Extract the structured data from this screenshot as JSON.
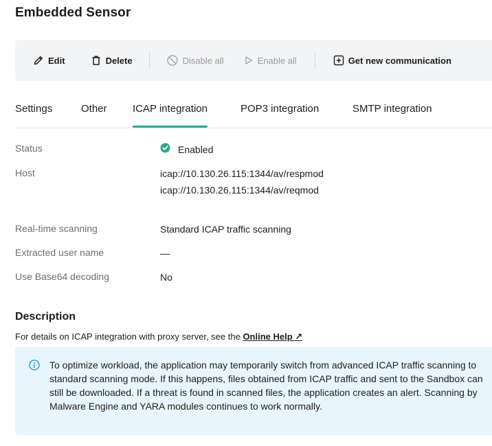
{
  "page": {
    "title": "Embedded Sensor"
  },
  "toolbar": {
    "edit_label": "Edit",
    "delete_label": "Delete",
    "disable_all_label": "Disable all",
    "enable_all_label": "Enable all",
    "get_comm_label": "Get new communication"
  },
  "tabs": [
    {
      "label": "Settings"
    },
    {
      "label": "Other"
    },
    {
      "label": "ICAP integration"
    },
    {
      "label": "POP3 integration"
    },
    {
      "label": "SMTP integration"
    }
  ],
  "details": {
    "status": {
      "label": "Status",
      "value": "Enabled"
    },
    "host": {
      "label": "Host",
      "values": [
        "icap://10.130.26.115:1344/av/respmod",
        "icap://10.130.26.115:1344/av/reqmod"
      ]
    },
    "realtime": {
      "label": "Real-time scanning",
      "value": "Standard ICAP traffic scanning"
    },
    "extracted_user": {
      "label": "Extracted user name",
      "value": "—"
    },
    "base64": {
      "label": "Use Base64 decoding",
      "value": "No"
    }
  },
  "description": {
    "title": "Description",
    "text": "For details on ICAP integration with proxy server, see the ",
    "link_label": "Online Help ↗"
  },
  "info_box": {
    "lines": [
      "To optimize workload, the application may temporarily switch from advanced ICAP traffic scanning to",
      "standard scanning mode. If this happens, files obtained from ICAP traffic and sent to the Sandbox can",
      "still be downloaded. If a threat is found in scanned files, the application creates an alert. Scanning by",
      "Malware Engine and YARA modules continues to work normally."
    ]
  },
  "colors": {
    "accent": "#2ba88e",
    "info_background": "#e9f5fc",
    "info_icon": "#1a8fd1",
    "toolbar_background": "#f3f4f6"
  }
}
